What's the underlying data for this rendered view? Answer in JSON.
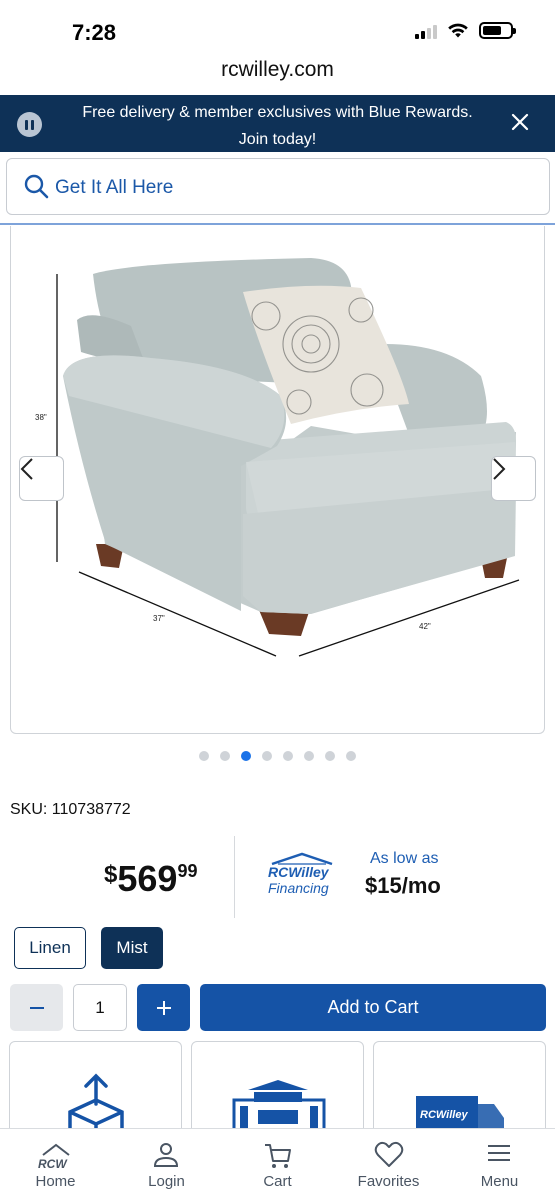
{
  "status_bar": {
    "time": "7:28"
  },
  "browser": {
    "url": "rcwilley.com"
  },
  "promo": {
    "text": "Free delivery & member exclusives with Blue Rewards. Join today!"
  },
  "search": {
    "placeholder": "Get It All Here"
  },
  "gallery": {
    "dimensions": {
      "height": "38\"",
      "depth": "37\"",
      "width": "42\""
    },
    "dots_total": 8,
    "active_dot": 3
  },
  "product": {
    "sku_label": "SKU: 110738772",
    "price": {
      "currency": "$",
      "dollars": "569",
      "cents": "99"
    },
    "financing": {
      "brand": "RCWilley",
      "label": "Financing",
      "as_low_as": "As low as",
      "monthly": "$15/mo"
    },
    "swatches": [
      {
        "label": "Linen",
        "selected": false
      },
      {
        "label": "Mist",
        "selected": true
      }
    ],
    "quantity": "1",
    "add_to_cart": "Add to Cart"
  },
  "feature_cards": [
    {
      "icon": "package-up-icon"
    },
    {
      "icon": "store-icon"
    },
    {
      "icon": "delivery-truck-icon",
      "brand": "RCWilley"
    }
  ],
  "bottom_nav": [
    {
      "label": "Home",
      "icon": "home-icon",
      "logo": "RCW"
    },
    {
      "label": "Login",
      "icon": "user-icon"
    },
    {
      "label": "Cart",
      "icon": "cart-icon"
    },
    {
      "label": "Favorites",
      "icon": "heart-icon"
    },
    {
      "label": "Menu",
      "icon": "menu-icon"
    }
  ],
  "colors": {
    "navy": "#0e3157",
    "brand_blue": "#1553a6",
    "link_blue": "#1e5eb3",
    "dot_active": "#1a72e8"
  }
}
